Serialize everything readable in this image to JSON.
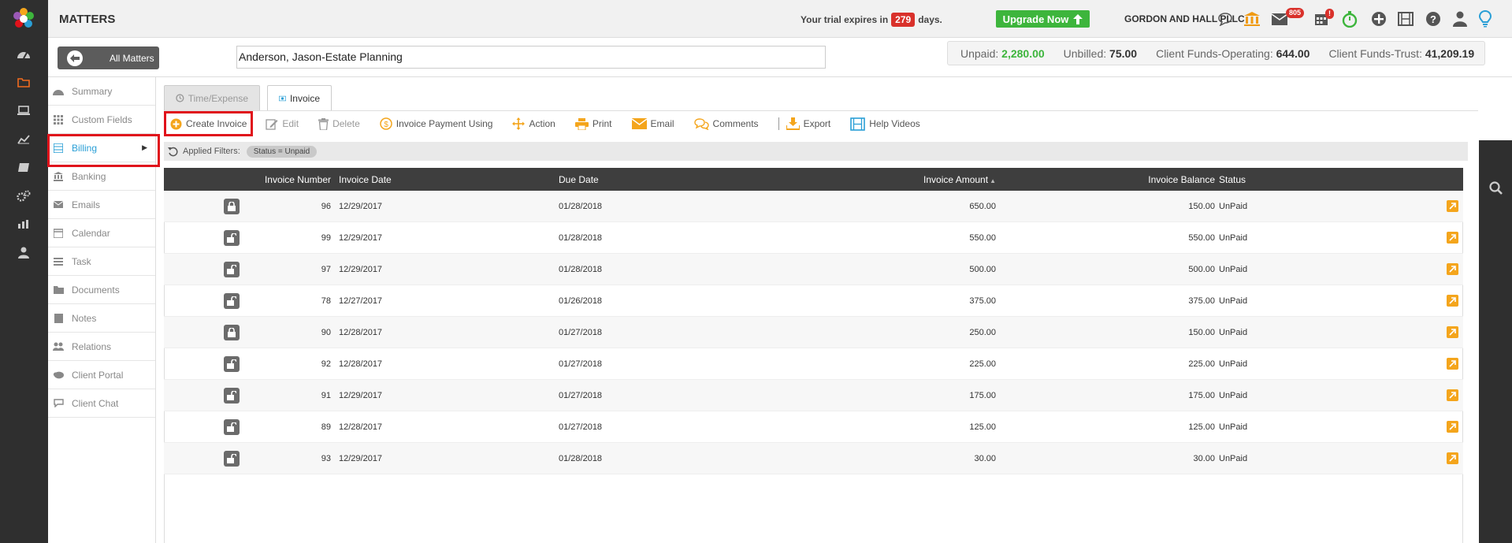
{
  "header": {
    "title": "MATTERS",
    "trial_prefix": "Your trial expires in",
    "trial_days": "279",
    "trial_suffix": "days.",
    "upgrade_label": "Upgrade Now",
    "firm_name": "GORDON AND HALL PLLC",
    "mail_badge": "805",
    "calendar_badge": "!"
  },
  "rail_icons": [
    "dashboard-icon",
    "folder-icon",
    "monitor-icon",
    "chart-line-icon",
    "book-icon",
    "settings-icon",
    "reports-icon",
    "user-icon"
  ],
  "matter": {
    "all_matters_label": "All Matters",
    "name": "Anderson, Jason-Estate Planning"
  },
  "summary": {
    "unpaid_label": "Unpaid:",
    "unpaid_value": "2,280.00",
    "unbilled_label": "Unbilled:",
    "unbilled_value": "75.00",
    "operating_label": "Client Funds-Operating:",
    "operating_value": "644.00",
    "trust_label": "Client Funds-Trust:",
    "trust_value": "41,209.19"
  },
  "submenu": [
    {
      "label": "Summary",
      "icon": "dashboard-icon"
    },
    {
      "label": "Custom Fields",
      "icon": "grid-icon"
    },
    {
      "label": "Billing",
      "icon": "billing-icon",
      "active": true
    },
    {
      "label": "Banking",
      "icon": "bank-icon"
    },
    {
      "label": "Emails",
      "icon": "envelope-icon"
    },
    {
      "label": "Calendar",
      "icon": "calendar-icon"
    },
    {
      "label": "Task",
      "icon": "task-icon"
    },
    {
      "label": "Documents",
      "icon": "folder-icon"
    },
    {
      "label": "Notes",
      "icon": "notes-icon"
    },
    {
      "label": "Relations",
      "icon": "users-icon"
    },
    {
      "label": "Client Portal",
      "icon": "portal-icon"
    },
    {
      "label": "Client Chat",
      "icon": "chat-icon"
    }
  ],
  "tabs": {
    "time_expense": "Time/Expense",
    "invoice": "Invoice"
  },
  "toolbar": {
    "create": "Create Invoice",
    "edit": "Edit",
    "delete": "Delete",
    "payment": "Invoice Payment Using",
    "action": "Action",
    "print": "Print",
    "email": "Email",
    "comments": "Comments",
    "export": "Export",
    "help": "Help Videos"
  },
  "filters": {
    "label": "Applied Filters:",
    "chip": "Status = Unpaid"
  },
  "table": {
    "columns": [
      "Invoice Number",
      "Invoice Date",
      "Due Date",
      "Invoice Amount",
      "Invoice Balance",
      "Status"
    ],
    "rows": [
      {
        "number": "96",
        "locked": true,
        "invoice_date": "12/29/2017",
        "due_date": "01/28/2018",
        "amount": "650.00",
        "balance": "150.00",
        "status": "UnPaid"
      },
      {
        "number": "99",
        "locked": false,
        "invoice_date": "12/29/2017",
        "due_date": "01/28/2018",
        "amount": "550.00",
        "balance": "550.00",
        "status": "UnPaid"
      },
      {
        "number": "97",
        "locked": false,
        "invoice_date": "12/29/2017",
        "due_date": "01/28/2018",
        "amount": "500.00",
        "balance": "500.00",
        "status": "UnPaid"
      },
      {
        "number": "78",
        "locked": false,
        "invoice_date": "12/27/2017",
        "due_date": "01/26/2018",
        "amount": "375.00",
        "balance": "375.00",
        "status": "UnPaid"
      },
      {
        "number": "90",
        "locked": true,
        "invoice_date": "12/28/2017",
        "due_date": "01/27/2018",
        "amount": "250.00",
        "balance": "150.00",
        "status": "UnPaid"
      },
      {
        "number": "92",
        "locked": false,
        "invoice_date": "12/28/2017",
        "due_date": "01/27/2018",
        "amount": "225.00",
        "balance": "225.00",
        "status": "UnPaid"
      },
      {
        "number": "91",
        "locked": false,
        "invoice_date": "12/29/2017",
        "due_date": "01/27/2018",
        "amount": "175.00",
        "balance": "175.00",
        "status": "UnPaid"
      },
      {
        "number": "89",
        "locked": false,
        "invoice_date": "12/28/2017",
        "due_date": "01/27/2018",
        "amount": "125.00",
        "balance": "125.00",
        "status": "UnPaid"
      },
      {
        "number": "93",
        "locked": false,
        "invoice_date": "12/29/2017",
        "due_date": "01/28/2018",
        "amount": "30.00",
        "balance": "30.00",
        "status": "UnPaid"
      }
    ]
  },
  "colors": {
    "accent": "#2a9fd6",
    "highlight": "#e0121b",
    "green": "#3db53c",
    "orange": "#f4a51c",
    "dark": "#2f2f2f"
  }
}
